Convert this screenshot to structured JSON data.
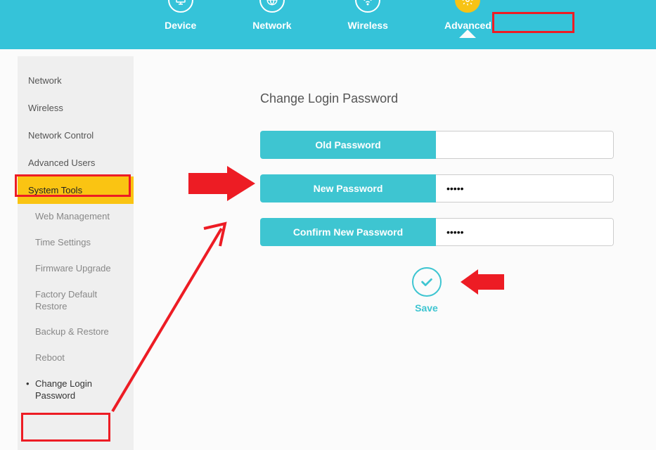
{
  "topNav": {
    "items": [
      {
        "label": "Device"
      },
      {
        "label": "Network"
      },
      {
        "label": "Wireless"
      },
      {
        "label": "Advanced"
      }
    ]
  },
  "sidebar": {
    "items": [
      {
        "label": "Network"
      },
      {
        "label": "Wireless"
      },
      {
        "label": "Network Control"
      },
      {
        "label": "Advanced Users"
      },
      {
        "label": "System Tools"
      }
    ],
    "subs": [
      {
        "label": "Web Management"
      },
      {
        "label": "Time Settings"
      },
      {
        "label": "Firmware Upgrade"
      },
      {
        "label": "Factory Default Restore"
      },
      {
        "label": "Backup & Restore"
      },
      {
        "label": "Reboot"
      },
      {
        "label": "Change Login Password"
      }
    ]
  },
  "main": {
    "title": "Change Login Password",
    "oldLabel": "Old Password",
    "oldValue": "",
    "newLabel": "New Password",
    "newValue": "•••••",
    "confirmLabel": "Confirm New Password",
    "confirmValue": "•••••",
    "saveLabel": "Save"
  }
}
